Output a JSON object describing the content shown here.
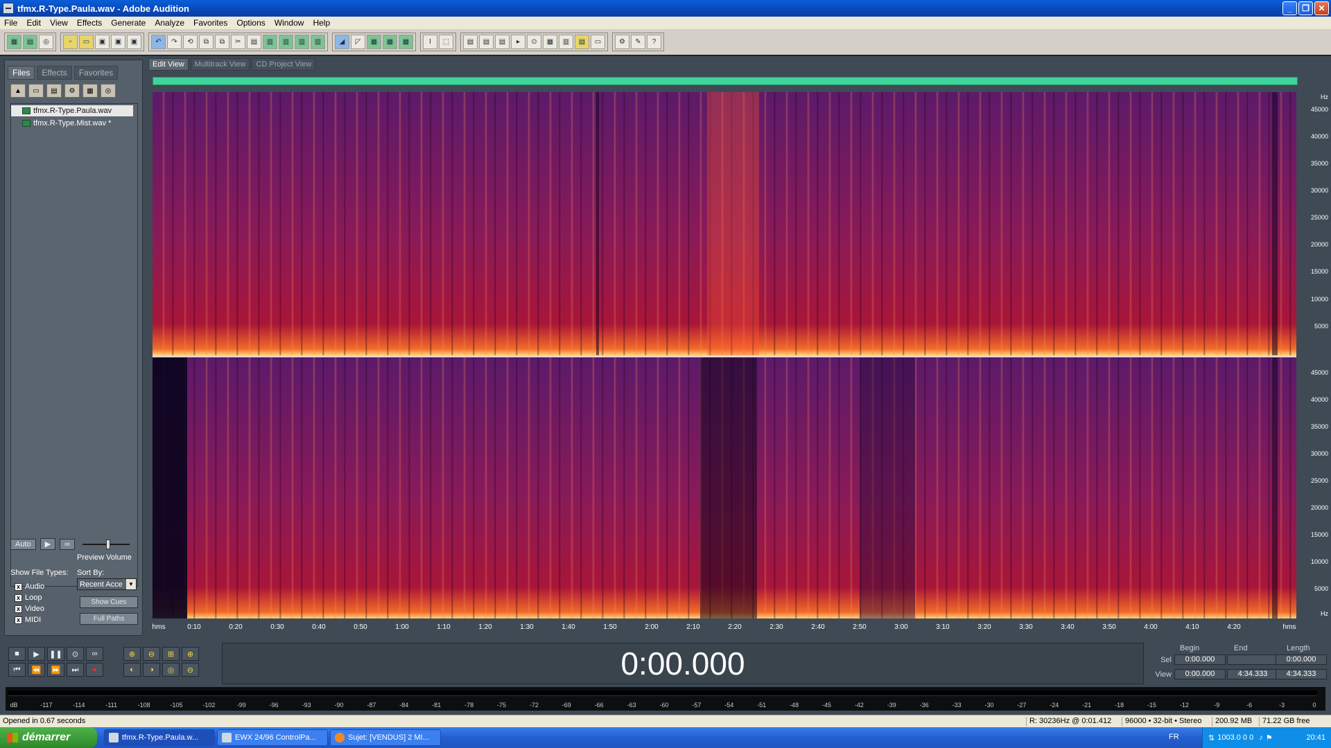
{
  "window": {
    "title": "tfmx.R-Type.Paula.wav - Adobe Audition",
    "controls": [
      "minimize-icon",
      "restore-icon",
      "close-icon"
    ]
  },
  "menu": [
    "File",
    "Edit",
    "View",
    "Effects",
    "Generate",
    "Analyze",
    "Favorites",
    "Options",
    "Window",
    "Help"
  ],
  "left_panel": {
    "tabs": [
      "Files",
      "Effects",
      "Favorites"
    ],
    "files": [
      "tfmx.R-Type.Paula.wav",
      "tfmx.R-Type.Mist.wav *"
    ],
    "auto_label": "Auto",
    "preview_volume_label": "Preview Volume",
    "show_file_types_label": "Show File Types:",
    "sort_by_label": "Sort By:",
    "sort_by_value": "Recent Acce",
    "file_types": [
      "Audio",
      "Loop",
      "Video",
      "MIDI"
    ],
    "show_cues_label": "Show Cues",
    "full_paths_label": "Full Paths"
  },
  "view_tabs": [
    "Edit View",
    "Multitrack View",
    "CD Project View"
  ],
  "spectral": {
    "hz_unit": "Hz",
    "channel1_hz": [
      "45000",
      "40000",
      "35000",
      "30000",
      "25000",
      "20000",
      "15000",
      "10000",
      "5000"
    ],
    "channel2_hz": [
      "45000",
      "40000",
      "35000",
      "30000",
      "25000",
      "20000",
      "15000",
      "10000",
      "5000"
    ],
    "colors": {
      "high": "#5c1a6a",
      "mid": "#b3142e",
      "low": "#ffd27a"
    }
  },
  "time_ruler": {
    "start_label": "hms",
    "end_label": "hms",
    "ticks": [
      "0:10",
      "0:20",
      "0:30",
      "0:40",
      "0:50",
      "1:00",
      "1:10",
      "1:20",
      "1:30",
      "1:40",
      "1:50",
      "2:00",
      "2:10",
      "2:20",
      "2:30",
      "2:40",
      "2:50",
      "3:00",
      "3:10",
      "3:20",
      "3:30",
      "3:40",
      "3:50",
      "4:00",
      "4:10",
      "4:20"
    ]
  },
  "transport": {
    "time_display": "0:00.000",
    "headers": {
      "begin": "Begin",
      "end": "End",
      "length": "Length"
    },
    "sel_label": "Sel",
    "view_label": "View",
    "sel": {
      "begin": "0:00.000",
      "end": "",
      "length": "0:00.000"
    },
    "view": {
      "begin": "0:00.000",
      "end": "4:34.333",
      "length": "4:34.333"
    }
  },
  "level_meter": {
    "labels": [
      "dB",
      "-117",
      "-114",
      "-111",
      "-108",
      "-105",
      "-102",
      "-99",
      "-96",
      "-93",
      "-90",
      "-87",
      "-84",
      "-81",
      "-78",
      "-75",
      "-72",
      "-69",
      "-66",
      "-63",
      "-60",
      "-57",
      "-54",
      "-51",
      "-48",
      "-45",
      "-42",
      "-39",
      "-36",
      "-33",
      "-30",
      "-27",
      "-24",
      "-21",
      "-18",
      "-15",
      "-12",
      "-9",
      "-6",
      "-3",
      "0"
    ]
  },
  "status_bar": {
    "message": "Opened in 0.67 seconds",
    "cursor": "R: 30236Hz @  0:01.412",
    "format": "96000 • 32-bit • Stereo",
    "file_size": "200.92 MB",
    "disk_free": "71.22 GB free"
  },
  "taskbar": {
    "start_label": "démarrer",
    "tasks": [
      "tfmx.R-Type.Paula.w...",
      "EWX 24/96 ControlPa...",
      "Sujet: [VENDUS] 2 MI..."
    ],
    "language": "FR",
    "tray_text": "1003.0  0  0",
    "clock": "20:41"
  }
}
